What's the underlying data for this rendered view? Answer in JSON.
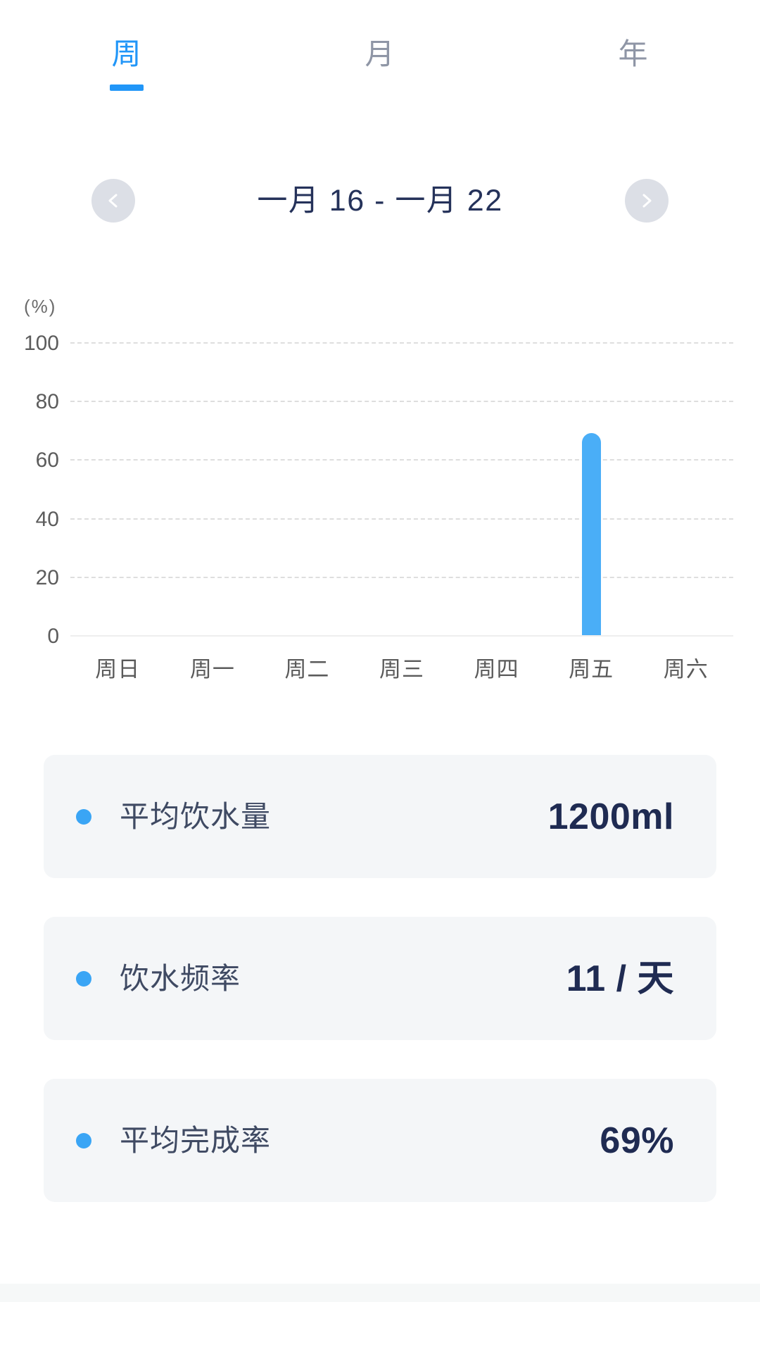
{
  "tabs": [
    {
      "label": "周",
      "active": true
    },
    {
      "label": "月",
      "active": false
    },
    {
      "label": "年",
      "active": false
    }
  ],
  "date_nav": {
    "prev_icon": "chevron-left-icon",
    "next_icon": "chevron-right-icon",
    "range_label": "一月 16 - 一月 22"
  },
  "chart_data": {
    "type": "bar",
    "title": "",
    "xlabel": "",
    "ylabel": "(%)",
    "unit_label": "(%)",
    "categories": [
      "周日",
      "周一",
      "周二",
      "周三",
      "周四",
      "周五",
      "周六"
    ],
    "values": [
      0,
      0,
      0,
      0,
      0,
      69,
      0
    ],
    "ylim": [
      0,
      100
    ],
    "yticks": [
      100,
      80,
      60,
      40,
      20,
      0
    ],
    "ytick_labels": [
      "100",
      "80",
      "60",
      "40",
      "20",
      "0"
    ],
    "grid": true,
    "legend": "none",
    "bar_color": "#4aaef7",
    "gridline_color": "#dedede",
    "axis_color": "#eeeeee"
  },
  "stats": [
    {
      "label": "平均饮水量",
      "value": "1200ml",
      "dot_color": "#3aa5f5"
    },
    {
      "label": "饮水频率",
      "value": "11 / 天",
      "dot_color": "#3aa5f5"
    },
    {
      "label": "平均完成率",
      "value": "69%",
      "dot_color": "#3aa5f5"
    }
  ],
  "theme": {
    "accent": "#2196f8",
    "bar": "#4aaef7",
    "text_dark": "#1f2b52",
    "text_muted": "#8f96a6",
    "card_bg": "#f4f6f8",
    "nav_btn_bg": "#dcdfe6",
    "bottom_band_bg": "#f6f8f8"
  }
}
